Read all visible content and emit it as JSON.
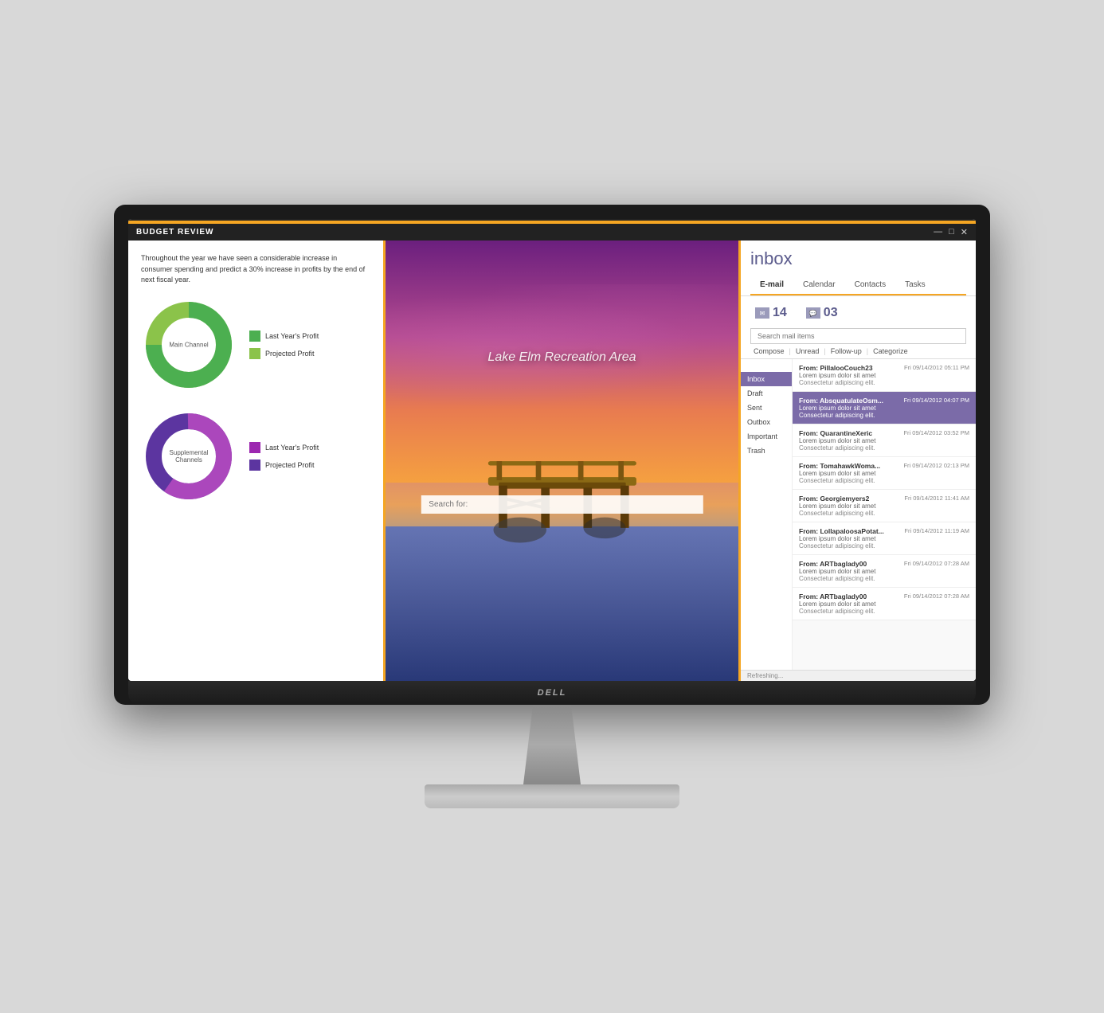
{
  "monitor": {
    "dell_label": "DELL"
  },
  "app": {
    "title": "BUDGET REVIEW",
    "window_controls": [
      "—",
      "□",
      "✕"
    ]
  },
  "budget": {
    "description": "Throughout the year we have seen a considerable increase in consumer spending and predict a 30% increase in profits by the end of next fiscal year.",
    "chart1": {
      "label": "Main Channel",
      "legend": [
        {
          "label": "Last Year's Profit",
          "color": "#4CAF50"
        },
        {
          "label": "Projected Profit",
          "color": "#8BC34A"
        }
      ],
      "segments": [
        {
          "pct": 75,
          "color": "#4CAF50"
        },
        {
          "pct": 25,
          "color": "#8BC34A"
        }
      ]
    },
    "chart2": {
      "label": "Supplemental\nChannels",
      "legend": [
        {
          "label": "Last Year's Profit",
          "color": "#9C27B0"
        },
        {
          "label": "Projected Profit",
          "color": "#5C35A0"
        }
      ],
      "segments": [
        {
          "pct": 60,
          "color": "#AB47BC"
        },
        {
          "pct": 40,
          "color": "#5C35A0"
        }
      ]
    }
  },
  "lake": {
    "title": "Lake Elm Recreation Area",
    "search_placeholder": "Search for:"
  },
  "inbox": {
    "title": "inbox",
    "nav_items": [
      "E-mail",
      "Calendar",
      "Contacts",
      "Tasks"
    ],
    "active_nav": "E-mail",
    "badge_email": "14",
    "badge_chat": "03",
    "search_placeholder": "Search mail items",
    "actions": [
      "Compose",
      "Unread",
      "Follow-up",
      "Categorize"
    ],
    "folders": [
      "Inbox",
      "Draft",
      "Sent",
      "Outbox",
      "Important",
      "Trash"
    ],
    "active_folder": "Inbox",
    "emails": [
      {
        "from": "From: PillalooCouch23",
        "preview": "Lorem ipsum dolor sit amet",
        "body": "Consectetur adipiscing elit.",
        "date": "Fri 09/14/2012 05:11 PM",
        "selected": false
      },
      {
        "from": "From: AbsquatulateOsm...",
        "preview": "Lorem ipsum dolor sit amet",
        "body": "Consectetur adipiscing elit.",
        "date": "Fri 09/14/2012 04:07 PM",
        "selected": true
      },
      {
        "from": "From: QuarantineXeric",
        "preview": "Lorem ipsum dolor sit amet",
        "body": "Consectetur adipiscing elit.",
        "date": "Fri 09/14/2012 03:52 PM",
        "selected": false
      },
      {
        "from": "From: TomahawkWoma...",
        "preview": "Lorem ipsum dolor sit amet",
        "body": "Consectetur adipiscing elit.",
        "date": "Fri 09/14/2012 02:13 PM",
        "selected": false
      },
      {
        "from": "From: Georgiemyers2",
        "preview": "Lorem ipsum dolor sit amet",
        "body": "Consectetur adipiscing elit.",
        "date": "Fri 09/14/2012 11:41 AM",
        "selected": false
      },
      {
        "from": "From: LollapaloosaPotat...",
        "preview": "Lorem ipsum dolor sit amet",
        "body": "Consectetur adipiscing elit.",
        "date": "Fri 09/14/2012 11:19 AM",
        "selected": false
      },
      {
        "from": "From: ARTbaglady00",
        "preview": "Lorem ipsum dolor sit amet",
        "body": "Consectetur adipiscing elit.",
        "date": "Fri 09/14/2012 07:28 AM",
        "selected": false
      },
      {
        "from": "From: ARTbaglady00",
        "preview": "Lorem ipsum dolor sit amet",
        "body": "Consectetur adipiscing elit.",
        "date": "Fri 09/14/2012 07:28 AM",
        "selected": false
      }
    ],
    "status": "Refreshing..."
  }
}
